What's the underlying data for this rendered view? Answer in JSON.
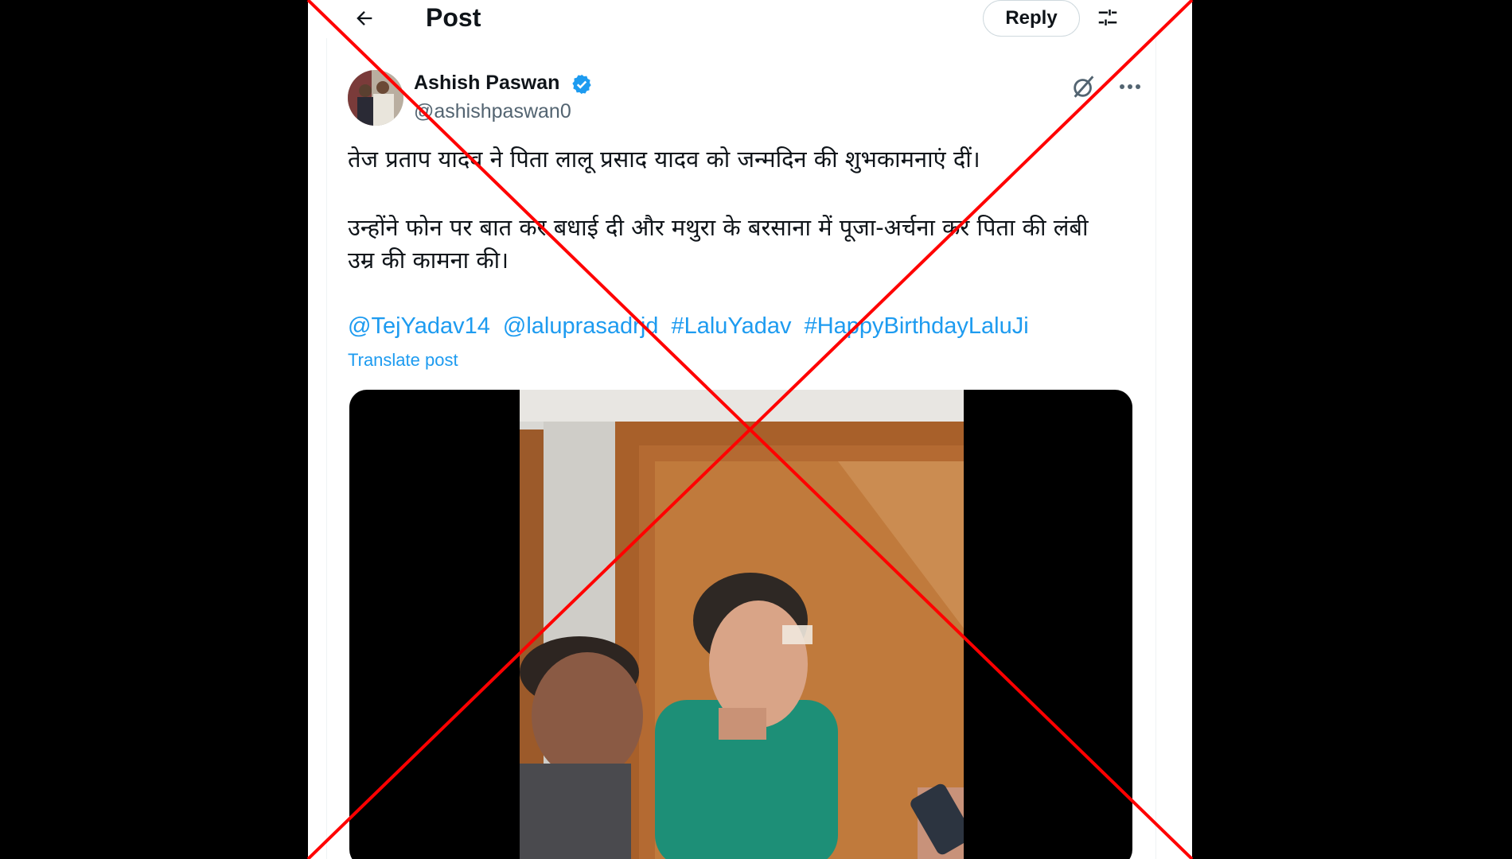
{
  "header": {
    "title": "Post",
    "reply_label": "Reply",
    "back_icon": "arrow-left-icon",
    "filter_icon": "sliders-icon"
  },
  "post": {
    "author_name": "Ashish Paswan",
    "handle": "@ashishpaswan0",
    "verified": true,
    "text_line1": "तेज प्रताप यादव ने पिता लालू प्रसाद यादव को जन्मदिन की शुभकामनाएं दीं।",
    "text_line2a": "उन्होंने फोन पर बात कर बधाई दी और मथुरा के बरसाना में पूजा-अर्चना कर पिता की लंबी",
    "text_line2b": "उम्र की कामना की।",
    "mentions": [
      "@TejYadav14",
      "@laluprasadrjd",
      "#LaluYadav",
      "#HappyBirthdayLaluJi"
    ],
    "translate_label": "Translate post"
  },
  "colors": {
    "link": "#1d9bf0",
    "text": "#0f1419",
    "secondary": "#536471",
    "overlay_cross": "#ff0000"
  }
}
